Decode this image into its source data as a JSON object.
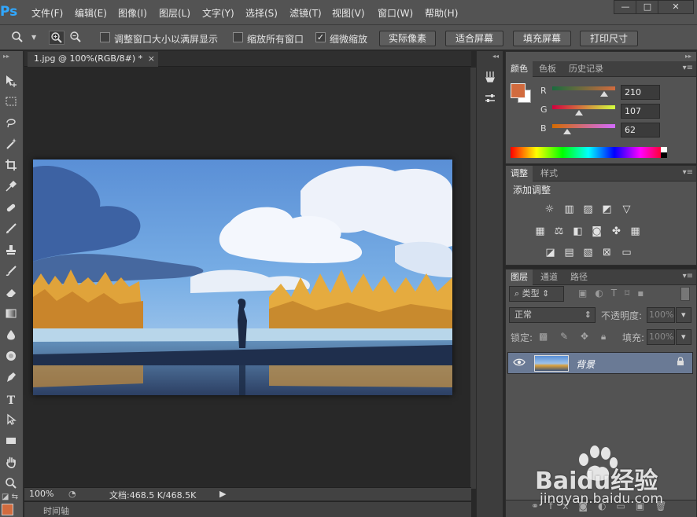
{
  "app": {
    "logo": "Ps"
  },
  "menu": [
    "文件(F)",
    "编辑(E)",
    "图像(I)",
    "图层(L)",
    "文字(Y)",
    "选择(S)",
    "滤镜(T)",
    "视图(V)",
    "窗口(W)",
    "帮助(H)"
  ],
  "window_controls": {
    "minimize": "—",
    "restore": "□",
    "close": "✕"
  },
  "options": {
    "resize_windows_label": "调整窗口大小以满屏显示",
    "zoom_all_label": "缩放所有窗口",
    "scrubby_zoom_label": "细微缩放",
    "scrubby_zoom_checked": "✓",
    "actual_pixels": "实际像素",
    "fit_screen": "适合屏幕",
    "fill_screen": "填充屏幕",
    "print_size": "打印尺寸"
  },
  "document": {
    "tab_title": "1.jpg @ 100%(RGB/8#) *",
    "close": "×",
    "zoom": "100%",
    "doc_size": "文档:468.5 K/468.5K",
    "timeline": "时间轴"
  },
  "color_panel": {
    "tabs": [
      "颜色",
      "色板",
      "历史记录"
    ],
    "fg_color": "#d26b3e",
    "channels": [
      {
        "label": "R",
        "value": "210"
      },
      {
        "label": "G",
        "value": "107"
      },
      {
        "label": "B",
        "value": "62"
      }
    ]
  },
  "adjust_panel": {
    "tabs": [
      "调整",
      "样式"
    ],
    "title": "添加调整"
  },
  "layers_panel": {
    "tabs": [
      "图层",
      "通道",
      "路径"
    ],
    "filter_kind": "类型",
    "blend_mode": "正常",
    "opacity_label": "不透明度:",
    "opacity_value": "100%",
    "lock_label": "锁定:",
    "fill_label": "填充:",
    "fill_value": "100%",
    "layers": [
      {
        "name": "背景"
      }
    ]
  },
  "watermark": {
    "brand": "Baidu经验",
    "url": "jingyan.baidu.com"
  },
  "icons": [
    "zoom-icon",
    "zoom-in-icon",
    "zoom-out-icon",
    "move-tool-icon",
    "marquee-tool-icon",
    "lasso-tool-icon",
    "magic-wand-icon",
    "crop-tool-icon",
    "eyedropper-icon",
    "healing-brush-icon",
    "brush-tool-icon",
    "clone-stamp-icon",
    "history-brush-icon",
    "eraser-icon",
    "gradient-icon",
    "blur-icon",
    "dodge-icon",
    "pen-tool-icon",
    "type-tool-icon",
    "path-select-icon",
    "rectangle-tool-icon",
    "hand-tool-icon",
    "zoom-tool-icon",
    "eye-icon",
    "lock-icon"
  ]
}
